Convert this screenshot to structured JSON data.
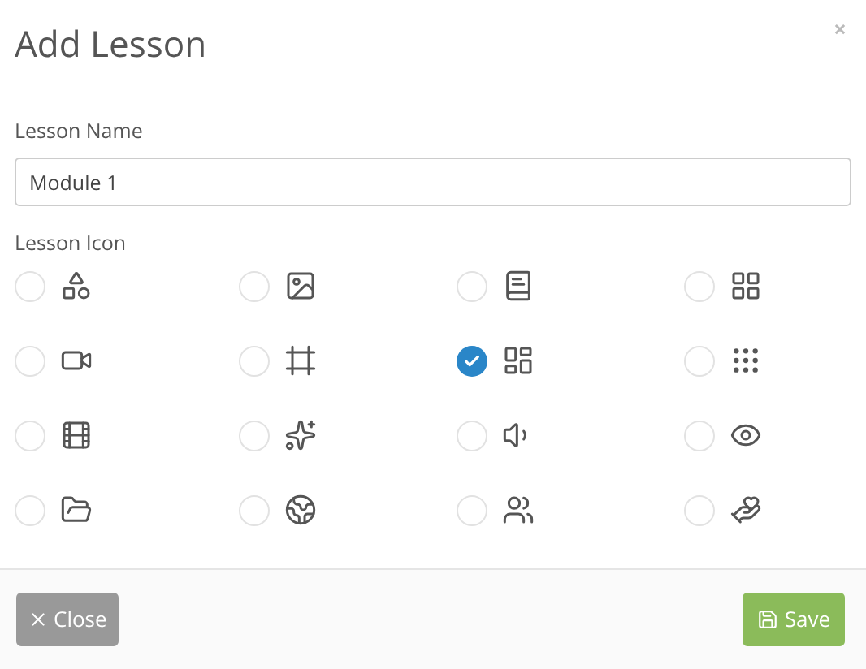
{
  "dialog": {
    "title": "Add Lesson",
    "close_glyph": "×"
  },
  "lesson_name": {
    "label": "Lesson Name",
    "value": "Module 1"
  },
  "lesson_icon": {
    "label": "Lesson Icon",
    "options": [
      {
        "kind": "shapes",
        "selected": false
      },
      {
        "kind": "image",
        "selected": false
      },
      {
        "kind": "book",
        "selected": false
      },
      {
        "kind": "grid",
        "selected": false
      },
      {
        "kind": "video",
        "selected": false
      },
      {
        "kind": "frame",
        "selected": false
      },
      {
        "kind": "dashboard",
        "selected": true
      },
      {
        "kind": "dots",
        "selected": false
      },
      {
        "kind": "film",
        "selected": false
      },
      {
        "kind": "sparkles",
        "selected": false
      },
      {
        "kind": "volume",
        "selected": false
      },
      {
        "kind": "eye",
        "selected": false
      },
      {
        "kind": "folder",
        "selected": false
      },
      {
        "kind": "globe",
        "selected": false
      },
      {
        "kind": "users",
        "selected": false
      },
      {
        "kind": "hand-heart",
        "selected": false
      }
    ]
  },
  "footer": {
    "close_label": "Close",
    "save_label": "Save"
  }
}
